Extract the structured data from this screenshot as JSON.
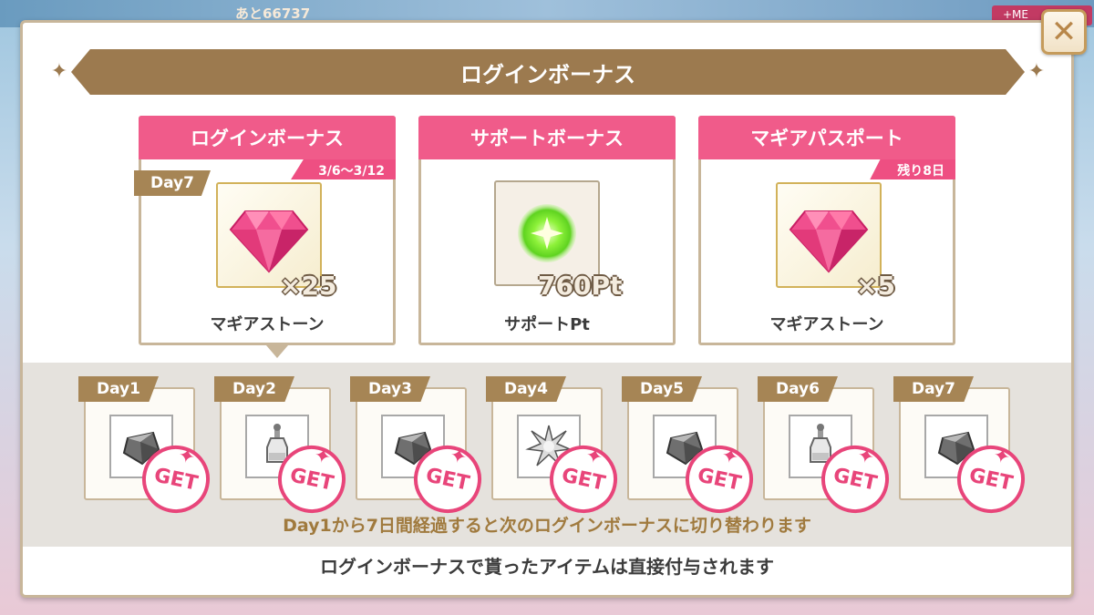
{
  "background": {
    "counter_text": "あと66737",
    "right_tab_label": "+ME"
  },
  "dialog": {
    "title": "ログインボーナス",
    "close_label": "✕"
  },
  "cards": [
    {
      "header": "ログインボーナス",
      "subheader": "3/6〜3/12",
      "day_tag": "Day7",
      "item_icon": "magia-stone-icon",
      "quantity": "×25",
      "item_name": "マギアストーン"
    },
    {
      "header": "サポートボーナス",
      "subheader": "",
      "day_tag": "",
      "item_icon": "support-point-icon",
      "quantity": "760Pt",
      "item_name": "サポートPt"
    },
    {
      "header": "マギアパスポート",
      "subheader": "残り8日",
      "day_tag": "",
      "item_icon": "magia-stone-icon",
      "quantity": "×5",
      "item_name": "マギアストーン"
    }
  ],
  "days": [
    {
      "label": "Day1",
      "icon": "gray-gem-icon",
      "badge": "GET"
    },
    {
      "label": "Day2",
      "icon": "potion-bottle-icon",
      "badge": "GET"
    },
    {
      "label": "Day3",
      "icon": "gray-gem-icon",
      "badge": "GET"
    },
    {
      "label": "Day4",
      "icon": "starburst-icon",
      "badge": "GET"
    },
    {
      "label": "Day5",
      "icon": "gray-gem-icon",
      "badge": "GET"
    },
    {
      "label": "Day6",
      "icon": "potion-bottle-icon",
      "badge": "GET"
    },
    {
      "label": "Day7",
      "icon": "gray-gem-icon",
      "badge": "GET"
    }
  ],
  "note": "Day1から7日間経過すると次のログインボーナスに切り替わります",
  "footer": "ログインボーナスで貰ったアイテムは直接付与されます",
  "colors": {
    "accent_pink": "#f05b8a",
    "banner_brown": "#9c7a4f",
    "frame_gold": "#d2b25a",
    "get_badge": "#e8457a"
  }
}
